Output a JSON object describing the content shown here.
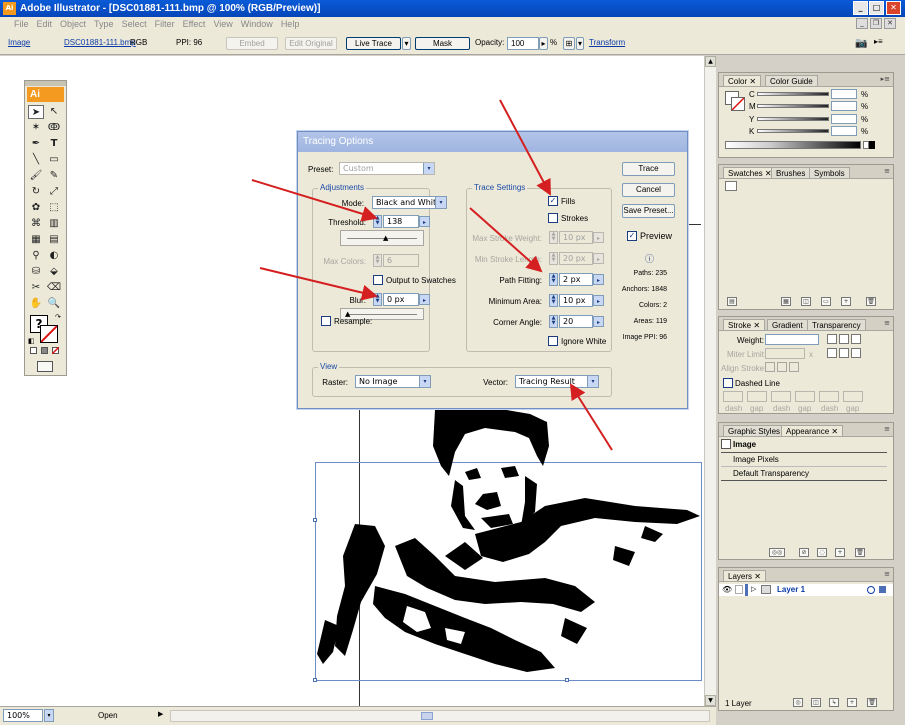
{
  "window": {
    "title": "Adobe Illustrator - [DSC01881-111.bmp @ 100% (RGB/Preview)]",
    "app_icon": "Ai",
    "minimize": "_",
    "maximize": "□",
    "close": "✕"
  },
  "menu": [
    "File",
    "Edit",
    "Object",
    "Type",
    "Select",
    "Filter",
    "Effect",
    "View",
    "Window",
    "Help"
  ],
  "control_bar": {
    "object_type": "Image",
    "filename": "DSC01881-111.bmp",
    "color_mode": "RGB",
    "ppi_label": "PPI: 96",
    "embed": "Embed",
    "edit_original": "Edit Original",
    "live_trace": "Live Trace",
    "mask": "Mask",
    "opacity_label": "Opacity:",
    "opacity_value": "100",
    "opacity_unit": "%",
    "transform": "Transform"
  },
  "tools": {
    "badge": "Ai",
    "fill_stroke_placeholder": "?"
  },
  "status_bar": {
    "zoom": "100%",
    "status": "Open"
  },
  "dialog": {
    "title": "Tracing Options",
    "preset_label": "Preset:",
    "preset_value": "Custom",
    "adjustments": {
      "title": "Adjustments",
      "mode_label": "Mode:",
      "mode_value": "Black and White",
      "threshold_label": "Threshold:",
      "threshold_value": "138",
      "max_colors_label": "Max Colors:",
      "max_colors_value": "6",
      "output_swatches": "Output to Swatches",
      "blur_label": "Blur:",
      "blur_value": "0 px",
      "resample_label": "Resample:"
    },
    "trace_settings": {
      "title": "Trace Settings",
      "fills": "Fills",
      "strokes": "Strokes",
      "max_stroke_weight_label": "Max Stroke Weight:",
      "max_stroke_weight_value": "10 px",
      "min_stroke_length_label": "Min Stroke Length:",
      "min_stroke_length_value": "20 px",
      "path_fitting_label": "Path Fitting:",
      "path_fitting_value": "2 px",
      "minimum_area_label": "Minimum Area:",
      "minimum_area_value": "10 px",
      "corner_angle_label": "Corner Angle:",
      "corner_angle_value": "20",
      "ignore_white": "Ignore White"
    },
    "view": {
      "title": "View",
      "raster_label": "Raster:",
      "raster_value": "No Image",
      "vector_label": "Vector:",
      "vector_value": "Tracing Result"
    },
    "buttons": {
      "trace": "Trace",
      "cancel": "Cancel",
      "save_preset": "Save Preset...",
      "preview": "Preview"
    },
    "stats": {
      "paths": "Paths: 235",
      "anchors": "Anchors: 1848",
      "colors": "Colors: 2",
      "areas": "Areas: 119",
      "image_ppi": "Image PPI: 96"
    }
  },
  "panels": {
    "color": {
      "tabs": [
        "Color",
        "Color Guide"
      ],
      "channels": [
        "C",
        "M",
        "Y",
        "K"
      ],
      "unit": "%"
    },
    "swatches": {
      "tabs": [
        "Swatches",
        "Brushes",
        "Symbols"
      ]
    },
    "stroke": {
      "tabs": [
        "Stroke",
        "Gradient",
        "Transparency"
      ],
      "weight_label": "Weight:",
      "miter_label": "Miter Limit:",
      "miter_unit": "x",
      "align_label": "Align Stroke:",
      "dashed_line": "Dashed Line",
      "dash_labels": [
        "dash",
        "gap",
        "dash",
        "gap",
        "dash",
        "gap"
      ]
    },
    "appearance": {
      "tabs": [
        "Graphic Styles",
        "Appearance"
      ],
      "items": [
        "Image",
        "Image Pixels",
        "Default Transparency"
      ]
    },
    "layers": {
      "tabs": [
        "Layers"
      ],
      "layer_name": "Layer 1",
      "footer": "1 Layer"
    }
  },
  "colors": {
    "accent": "#0a5bd8",
    "annotation_arrow": "#d42020"
  }
}
